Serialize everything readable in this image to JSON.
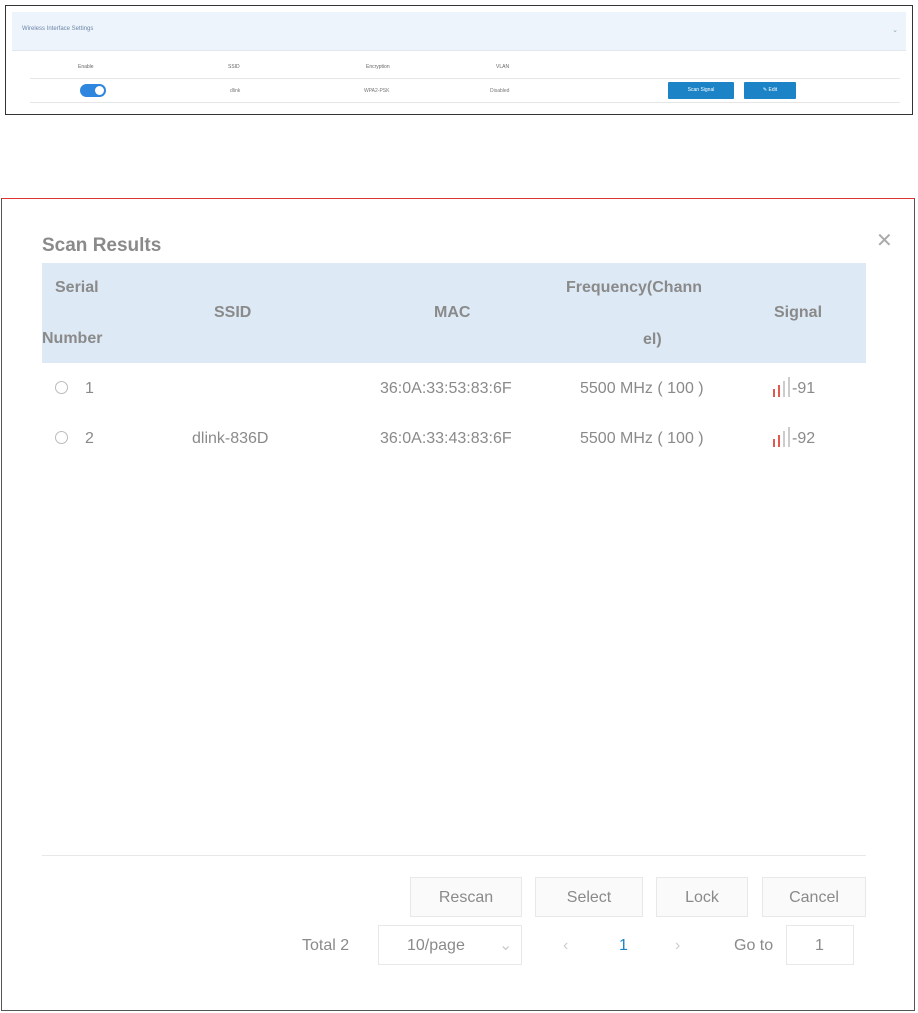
{
  "top_panel": {
    "title": "Wireless Interface Settings",
    "columns": [
      "Enable",
      "SSID",
      "Encryption",
      "VLAN"
    ],
    "row": {
      "enabled": true,
      "ssid": "dlink",
      "encryption": "WPA2-PSK",
      "vlan": "Disabled"
    },
    "buttons": {
      "scan": "Scan Signal",
      "edit": "Edit"
    }
  },
  "dialog": {
    "title": "Scan Results",
    "headers": {
      "serial_line1": "Serial",
      "serial_line2": "Number",
      "ssid": "SSID",
      "mac": "MAC",
      "freq_line1": "Frequency(Chann",
      "freq_line2": "el)",
      "signal": "Signal"
    },
    "rows": [
      {
        "serial": "1",
        "ssid": "",
        "mac": "36:0A:33:53:83:6F",
        "frequency": "5500 MHz ( 100 )",
        "signal": "-91"
      },
      {
        "serial": "2",
        "ssid": "dlink-836D",
        "mac": "36:0A:33:43:83:6F",
        "frequency": "5500 MHz ( 100 )",
        "signal": "-92"
      }
    ],
    "buttons": {
      "rescan": "Rescan",
      "select": "Select",
      "lock": "Lock",
      "cancel": "Cancel"
    },
    "pagination": {
      "total": "Total 2",
      "page_size": "10/page",
      "current_page": "1",
      "goto_label": "Go to",
      "goto_value": "1"
    }
  },
  "colors": {
    "accent": "#1c84c6",
    "header_bg": "#dde9f5",
    "signal_weak": "#e05a4f"
  }
}
